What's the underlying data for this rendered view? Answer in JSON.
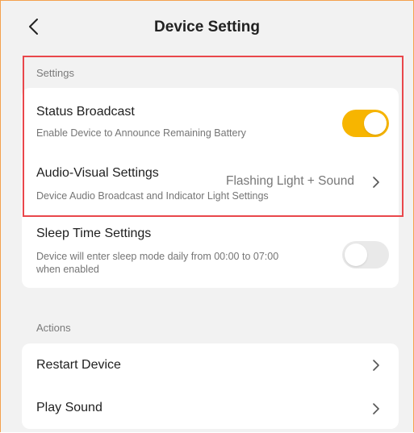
{
  "header": {
    "title": "Device Setting"
  },
  "settings_section": {
    "label": "Settings",
    "status_broadcast": {
      "title": "Status Broadcast",
      "description": "Enable Device to Announce Remaining Battery",
      "enabled": true
    },
    "audio_visual": {
      "title": "Audio-Visual Settings",
      "description": "Device Audio Broadcast and Indicator Light Settings",
      "value": "Flashing Light + Sound"
    },
    "sleep_time": {
      "title": "Sleep Time Settings",
      "description_line1": "Device will enter sleep mode daily from 00:00 to 07:00",
      "description_line2": "when enabled",
      "enabled": false
    }
  },
  "actions_section": {
    "label": "Actions",
    "items": [
      {
        "label": "Restart Device"
      },
      {
        "label": "Play Sound"
      }
    ]
  },
  "colors": {
    "toggle_on": "#f7b500",
    "toggle_off": "#e9e9e9",
    "highlight_border": "#e9474b",
    "frame_border": "#f4a14e",
    "page_background": "#f2f2f2"
  },
  "icons": {
    "back": "chevron-left-icon",
    "row_arrow": "chevron-right-icon"
  }
}
